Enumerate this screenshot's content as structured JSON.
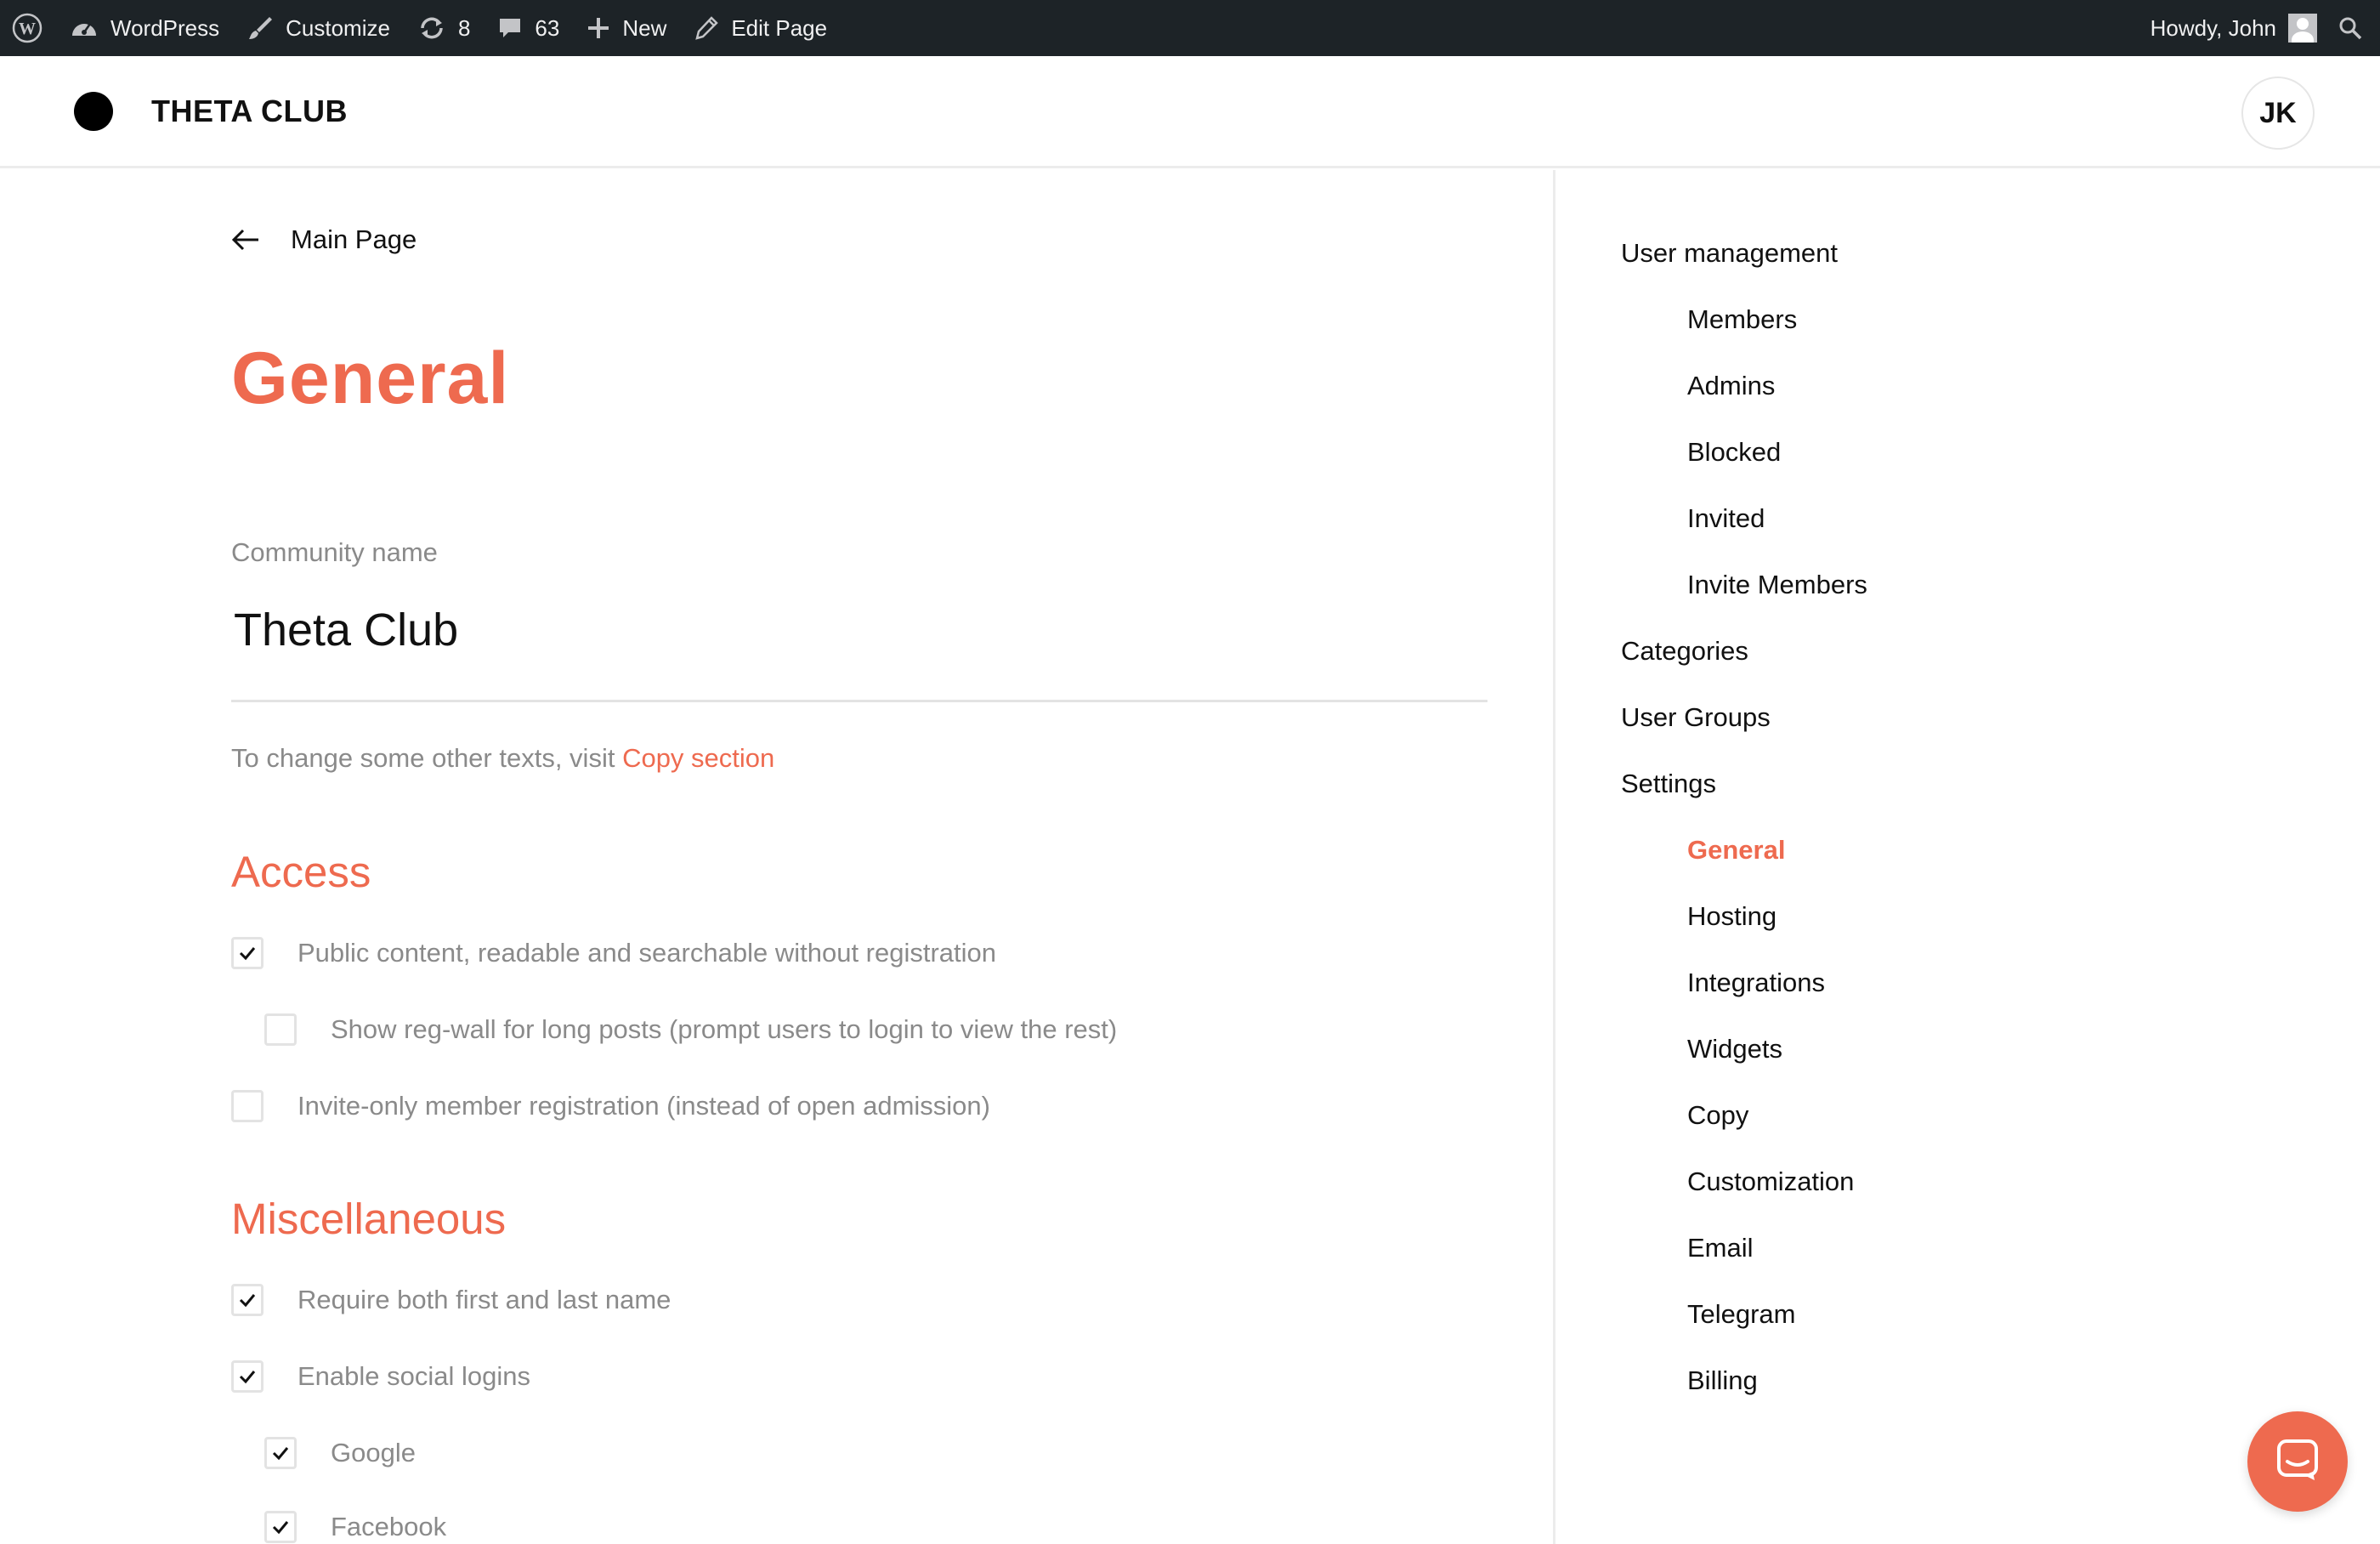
{
  "admin_bar": {
    "site_label": "WordPress",
    "customize_label": "Customize",
    "updates_count": "8",
    "comments_count": "63",
    "new_label": "New",
    "edit_label": "Edit Page",
    "howdy": "Howdy, John"
  },
  "header": {
    "site_title": "THETA CLUB",
    "user_initials": "JK"
  },
  "main": {
    "back_label": "Main Page",
    "page_title": "General",
    "community_label": "Community name",
    "community_value": "Theta Club",
    "hint_prefix": "To change some other texts, visit ",
    "hint_link": "Copy section",
    "access_title": "Access",
    "access_options": [
      {
        "label": "Public content, readable and searchable without registration",
        "checked": true
      },
      {
        "label": "Show reg-wall for long posts (prompt users to login to view the rest)",
        "checked": false
      },
      {
        "label": "Invite-only member registration (instead of open admission)",
        "checked": false
      }
    ],
    "misc_title": "Miscellaneous",
    "misc_options": [
      {
        "label": "Require both first and last name",
        "checked": true
      },
      {
        "label": "Enable social logins",
        "checked": true
      },
      {
        "label": "Google",
        "checked": true
      },
      {
        "label": "Facebook",
        "checked": true
      }
    ]
  },
  "sidebar": {
    "user_management": "User management",
    "members": "Members",
    "admins": "Admins",
    "blocked": "Blocked",
    "invited": "Invited",
    "invite_members": "Invite Members",
    "categories": "Categories",
    "user_groups": "User Groups",
    "settings": "Settings",
    "general": "General",
    "hosting": "Hosting",
    "integrations": "Integrations",
    "widgets": "Widgets",
    "copy": "Copy",
    "customization": "Customization",
    "email": "Email",
    "telegram": "Telegram",
    "billing": "Billing"
  },
  "colors": {
    "accent": "#ee6a4f",
    "admin_bar": "#1d2327"
  },
  "icons": {
    "wp_logo": "wordpress-logo-icon",
    "dashboard": "dashboard-icon",
    "customize": "brush-icon",
    "updates": "refresh-icon",
    "comments": "comment-icon",
    "new": "plus-icon",
    "edit": "pencil-icon",
    "search": "search-icon",
    "back": "arrow-left-icon",
    "chat": "chat-icon"
  }
}
